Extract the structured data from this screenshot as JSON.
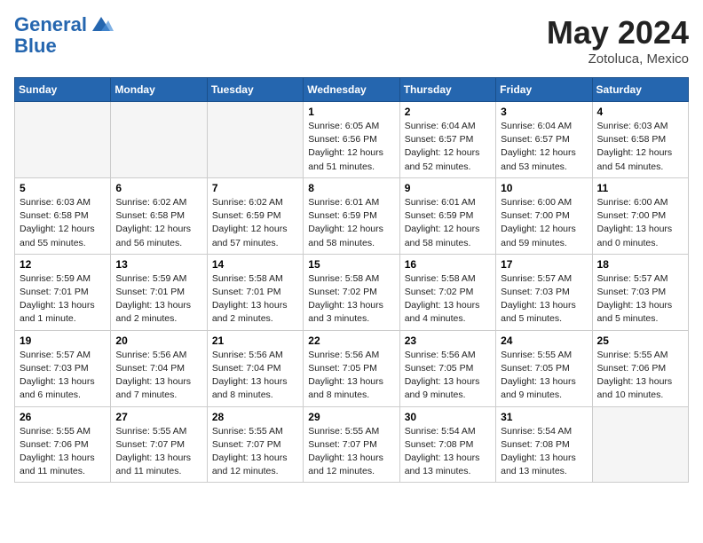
{
  "header": {
    "logo_line1": "General",
    "logo_line2": "Blue",
    "month": "May 2024",
    "location": "Zotoluca, Mexico"
  },
  "weekdays": [
    "Sunday",
    "Monday",
    "Tuesday",
    "Wednesday",
    "Thursday",
    "Friday",
    "Saturday"
  ],
  "weeks": [
    [
      {
        "day": "",
        "info": ""
      },
      {
        "day": "",
        "info": ""
      },
      {
        "day": "",
        "info": ""
      },
      {
        "day": "1",
        "info": "Sunrise: 6:05 AM\nSunset: 6:56 PM\nDaylight: 12 hours\nand 51 minutes."
      },
      {
        "day": "2",
        "info": "Sunrise: 6:04 AM\nSunset: 6:57 PM\nDaylight: 12 hours\nand 52 minutes."
      },
      {
        "day": "3",
        "info": "Sunrise: 6:04 AM\nSunset: 6:57 PM\nDaylight: 12 hours\nand 53 minutes."
      },
      {
        "day": "4",
        "info": "Sunrise: 6:03 AM\nSunset: 6:58 PM\nDaylight: 12 hours\nand 54 minutes."
      }
    ],
    [
      {
        "day": "5",
        "info": "Sunrise: 6:03 AM\nSunset: 6:58 PM\nDaylight: 12 hours\nand 55 minutes."
      },
      {
        "day": "6",
        "info": "Sunrise: 6:02 AM\nSunset: 6:58 PM\nDaylight: 12 hours\nand 56 minutes."
      },
      {
        "day": "7",
        "info": "Sunrise: 6:02 AM\nSunset: 6:59 PM\nDaylight: 12 hours\nand 57 minutes."
      },
      {
        "day": "8",
        "info": "Sunrise: 6:01 AM\nSunset: 6:59 PM\nDaylight: 12 hours\nand 58 minutes."
      },
      {
        "day": "9",
        "info": "Sunrise: 6:01 AM\nSunset: 6:59 PM\nDaylight: 12 hours\nand 58 minutes."
      },
      {
        "day": "10",
        "info": "Sunrise: 6:00 AM\nSunset: 7:00 PM\nDaylight: 12 hours\nand 59 minutes."
      },
      {
        "day": "11",
        "info": "Sunrise: 6:00 AM\nSunset: 7:00 PM\nDaylight: 13 hours\nand 0 minutes."
      }
    ],
    [
      {
        "day": "12",
        "info": "Sunrise: 5:59 AM\nSunset: 7:01 PM\nDaylight: 13 hours\nand 1 minute."
      },
      {
        "day": "13",
        "info": "Sunrise: 5:59 AM\nSunset: 7:01 PM\nDaylight: 13 hours\nand 2 minutes."
      },
      {
        "day": "14",
        "info": "Sunrise: 5:58 AM\nSunset: 7:01 PM\nDaylight: 13 hours\nand 2 minutes."
      },
      {
        "day": "15",
        "info": "Sunrise: 5:58 AM\nSunset: 7:02 PM\nDaylight: 13 hours\nand 3 minutes."
      },
      {
        "day": "16",
        "info": "Sunrise: 5:58 AM\nSunset: 7:02 PM\nDaylight: 13 hours\nand 4 minutes."
      },
      {
        "day": "17",
        "info": "Sunrise: 5:57 AM\nSunset: 7:03 PM\nDaylight: 13 hours\nand 5 minutes."
      },
      {
        "day": "18",
        "info": "Sunrise: 5:57 AM\nSunset: 7:03 PM\nDaylight: 13 hours\nand 5 minutes."
      }
    ],
    [
      {
        "day": "19",
        "info": "Sunrise: 5:57 AM\nSunset: 7:03 PM\nDaylight: 13 hours\nand 6 minutes."
      },
      {
        "day": "20",
        "info": "Sunrise: 5:56 AM\nSunset: 7:04 PM\nDaylight: 13 hours\nand 7 minutes."
      },
      {
        "day": "21",
        "info": "Sunrise: 5:56 AM\nSunset: 7:04 PM\nDaylight: 13 hours\nand 8 minutes."
      },
      {
        "day": "22",
        "info": "Sunrise: 5:56 AM\nSunset: 7:05 PM\nDaylight: 13 hours\nand 8 minutes."
      },
      {
        "day": "23",
        "info": "Sunrise: 5:56 AM\nSunset: 7:05 PM\nDaylight: 13 hours\nand 9 minutes."
      },
      {
        "day": "24",
        "info": "Sunrise: 5:55 AM\nSunset: 7:05 PM\nDaylight: 13 hours\nand 9 minutes."
      },
      {
        "day": "25",
        "info": "Sunrise: 5:55 AM\nSunset: 7:06 PM\nDaylight: 13 hours\nand 10 minutes."
      }
    ],
    [
      {
        "day": "26",
        "info": "Sunrise: 5:55 AM\nSunset: 7:06 PM\nDaylight: 13 hours\nand 11 minutes."
      },
      {
        "day": "27",
        "info": "Sunrise: 5:55 AM\nSunset: 7:07 PM\nDaylight: 13 hours\nand 11 minutes."
      },
      {
        "day": "28",
        "info": "Sunrise: 5:55 AM\nSunset: 7:07 PM\nDaylight: 13 hours\nand 12 minutes."
      },
      {
        "day": "29",
        "info": "Sunrise: 5:55 AM\nSunset: 7:07 PM\nDaylight: 13 hours\nand 12 minutes."
      },
      {
        "day": "30",
        "info": "Sunrise: 5:54 AM\nSunset: 7:08 PM\nDaylight: 13 hours\nand 13 minutes."
      },
      {
        "day": "31",
        "info": "Sunrise: 5:54 AM\nSunset: 7:08 PM\nDaylight: 13 hours\nand 13 minutes."
      },
      {
        "day": "",
        "info": ""
      }
    ]
  ]
}
